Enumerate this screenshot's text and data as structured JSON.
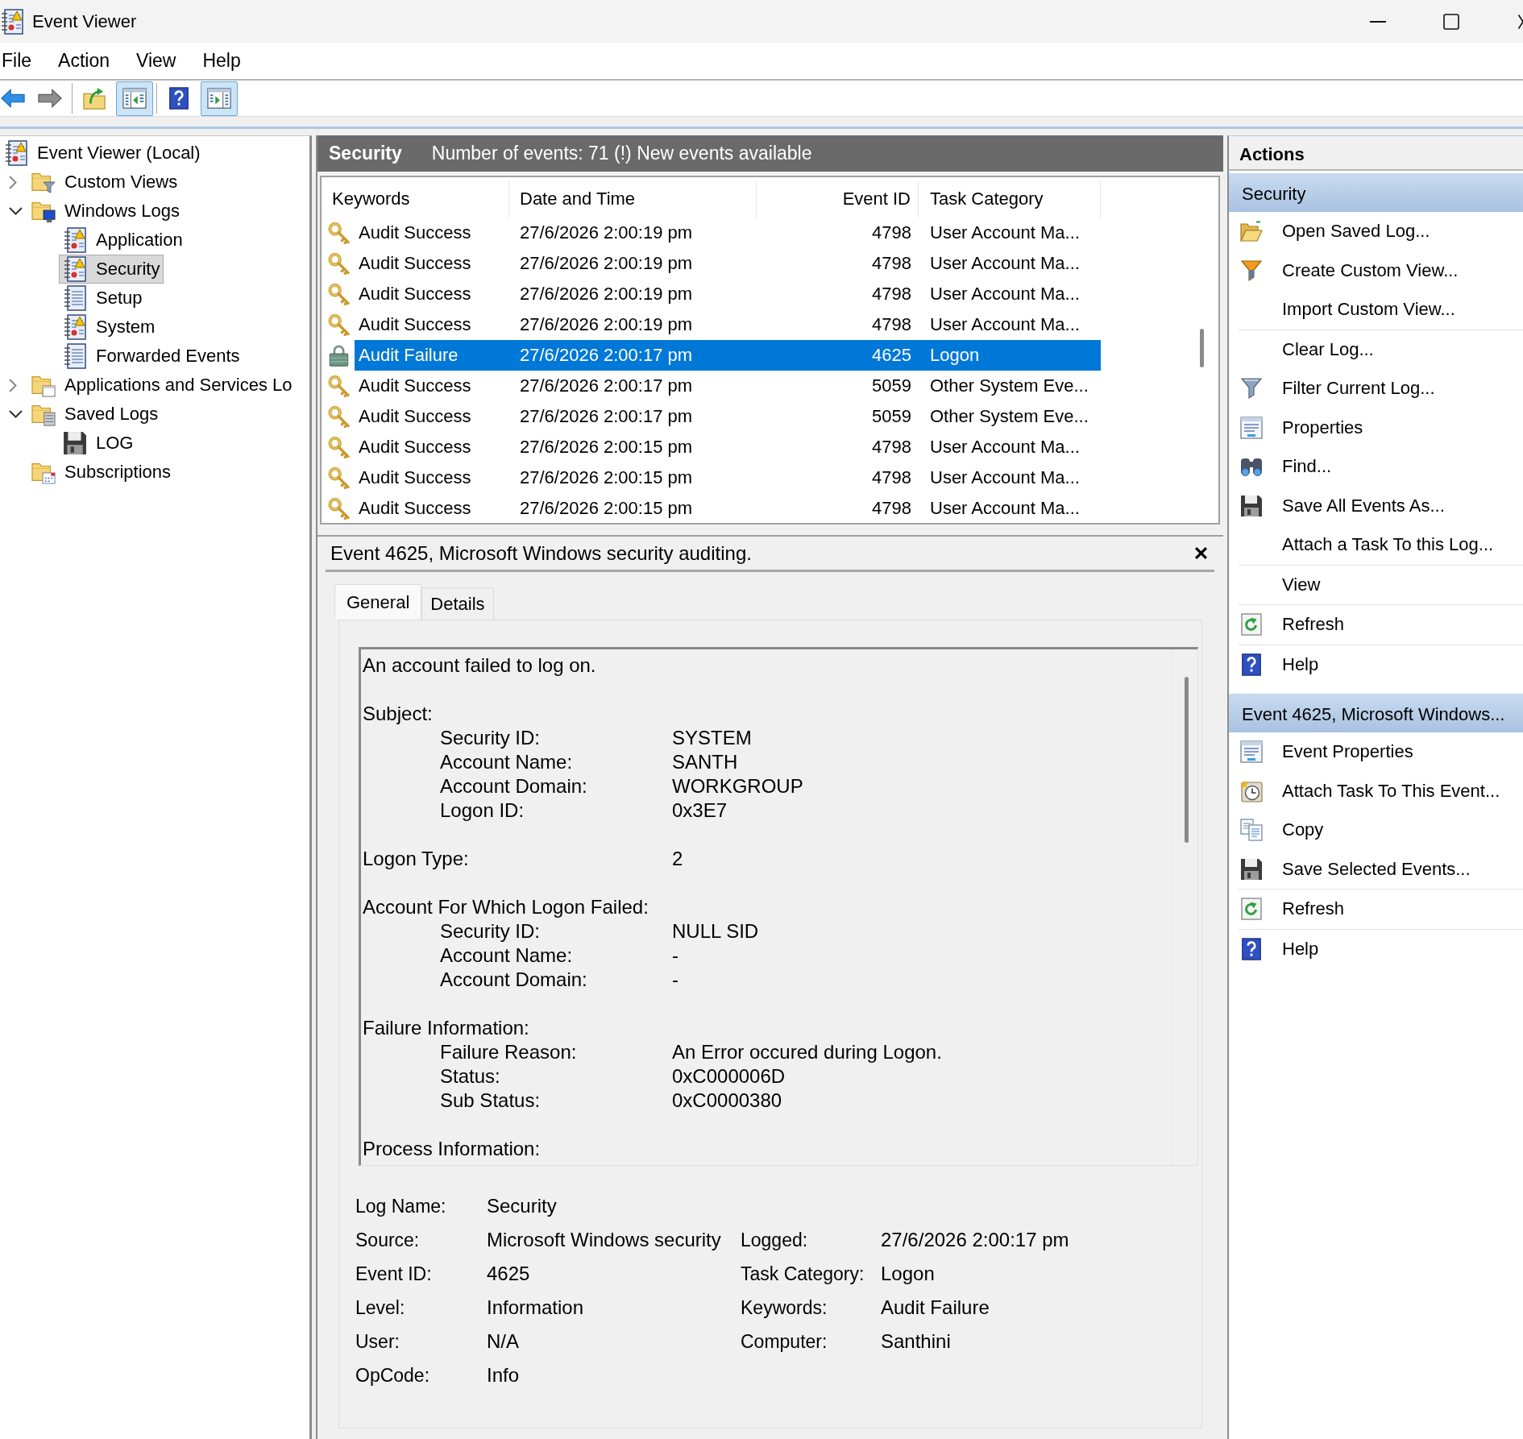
{
  "window": {
    "title": "Event Viewer"
  },
  "menu": [
    "File",
    "Action",
    "View",
    "Help"
  ],
  "toolbar": {
    "groups": [
      [
        {
          "kind": "back",
          "pressed": false
        },
        {
          "kind": "forward",
          "pressed": false
        }
      ],
      [
        {
          "kind": "open-folder",
          "pressed": false
        },
        {
          "kind": "console-tree",
          "pressed": true
        }
      ],
      [
        {
          "kind": "help",
          "pressed": false
        },
        {
          "kind": "action-pane",
          "pressed": true
        }
      ]
    ]
  },
  "tree": {
    "label": "Event Viewer (Local)",
    "kind": "root",
    "selected": false,
    "children": [
      {
        "label": "Custom Views",
        "kind": "filter-folder",
        "expanded": false,
        "selected": false
      },
      {
        "label": "Windows Logs",
        "kind": "system-folder",
        "expanded": true,
        "selected": false,
        "children": [
          {
            "label": "Application",
            "kind": "alert-log",
            "selected": false
          },
          {
            "label": "Security",
            "kind": "alert-log",
            "selected": true
          },
          {
            "label": "Setup",
            "kind": "plain-log",
            "selected": false
          },
          {
            "label": "System",
            "kind": "alert-log",
            "selected": false
          },
          {
            "label": "Forwarded Events",
            "kind": "plain-log",
            "selected": false
          }
        ]
      },
      {
        "label": "Applications and Services Lo",
        "kind": "window-folder",
        "expanded": false,
        "selected": false
      },
      {
        "label": "Saved Logs",
        "kind": "list-folder",
        "expanded": true,
        "selected": false,
        "children": [
          {
            "label": "LOG",
            "kind": "disk",
            "selected": false
          }
        ]
      },
      {
        "label": "Subscriptions",
        "kind": "calendar-folder",
        "selected": false
      }
    ]
  },
  "log_header": {
    "title": "Security",
    "summary": "Number of events: 71 (!) New events available"
  },
  "table": {
    "columns": [
      "Keywords",
      "Date and Time",
      "Event ID",
      "Task Category"
    ],
    "rows": [
      {
        "kind": "success",
        "keywords": "Audit Success",
        "date_time": "27/6/2026 2:00:19 pm",
        "event_id": "4798",
        "task_category": "User Account Ma...",
        "selected": false
      },
      {
        "kind": "success",
        "keywords": "Audit Success",
        "date_time": "27/6/2026 2:00:19 pm",
        "event_id": "4798",
        "task_category": "User Account Ma...",
        "selected": false
      },
      {
        "kind": "success",
        "keywords": "Audit Success",
        "date_time": "27/6/2026 2:00:19 pm",
        "event_id": "4798",
        "task_category": "User Account Ma...",
        "selected": false
      },
      {
        "kind": "success",
        "keywords": "Audit Success",
        "date_time": "27/6/2026 2:00:19 pm",
        "event_id": "4798",
        "task_category": "User Account Ma...",
        "selected": false
      },
      {
        "kind": "failure",
        "keywords": "Audit Failure",
        "date_time": "27/6/2026 2:00:17 pm",
        "event_id": "4625",
        "task_category": "Logon",
        "selected": true
      },
      {
        "kind": "success",
        "keywords": "Audit Success",
        "date_time": "27/6/2026 2:00:17 pm",
        "event_id": "5059",
        "task_category": "Other System Eve...",
        "selected": false
      },
      {
        "kind": "success",
        "keywords": "Audit Success",
        "date_time": "27/6/2026 2:00:17 pm",
        "event_id": "5059",
        "task_category": "Other System Eve...",
        "selected": false
      },
      {
        "kind": "success",
        "keywords": "Audit Success",
        "date_time": "27/6/2026 2:00:15 pm",
        "event_id": "4798",
        "task_category": "User Account Ma...",
        "selected": false
      },
      {
        "kind": "success",
        "keywords": "Audit Success",
        "date_time": "27/6/2026 2:00:15 pm",
        "event_id": "4798",
        "task_category": "User Account Ma...",
        "selected": false
      },
      {
        "kind": "success",
        "keywords": "Audit Success",
        "date_time": "27/6/2026 2:00:15 pm",
        "event_id": "4798",
        "task_category": "User Account Ma...",
        "selected": false
      }
    ]
  },
  "event_details": {
    "title": "Event 4625, Microsoft Windows security auditing.",
    "tabs": [
      {
        "label": "General",
        "selected": true
      },
      {
        "label": "Details",
        "selected": false
      }
    ],
    "description": "An account failed to log on.",
    "sections": [
      {
        "title": "Subject:",
        "fields": [
          {
            "label": "Security ID:",
            "value": "SYSTEM"
          },
          {
            "label": "Account Name:",
            "value": "SANTH"
          },
          {
            "label": "Account Domain:",
            "value": "WORKGROUP"
          },
          {
            "label": "Logon ID:",
            "value": "0x3E7"
          }
        ]
      },
      {
        "title": "Logon Type:",
        "value": "2"
      },
      {
        "title": "Account For Which Logon Failed:",
        "fields": [
          {
            "label": "Security ID:",
            "value": "NULL SID"
          },
          {
            "label": "Account Name:",
            "value": "-"
          },
          {
            "label": "Account Domain:",
            "value": "-"
          }
        ]
      },
      {
        "title": "Failure Information:",
        "fields": [
          {
            "label": "Failure Reason:",
            "value": "An Error occured during Logon."
          },
          {
            "label": "Status:",
            "value": "0xC000006D"
          },
          {
            "label": "Sub Status:",
            "value": "0xC0000380"
          }
        ]
      },
      {
        "title": "Process Information:"
      }
    ],
    "summary_rows": [
      [
        {
          "label": "Log Name:",
          "value": "Security"
        }
      ],
      [
        {
          "label": "Source:",
          "value": "Microsoft Windows security"
        },
        {
          "label": "Logged:",
          "value": "27/6/2026 2:00:17 pm"
        }
      ],
      [
        {
          "label": "Event ID:",
          "value": "4625"
        },
        {
          "label": "Task Category:",
          "value": "Logon"
        }
      ],
      [
        {
          "label": "Level:",
          "value": "Information"
        },
        {
          "label": "Keywords:",
          "value": "Audit Failure"
        }
      ],
      [
        {
          "label": "User:",
          "value": "N/A"
        },
        {
          "label": "Computer:",
          "value": "Santhini"
        }
      ],
      [
        {
          "label": "OpCode:",
          "value": "Info"
        }
      ]
    ]
  },
  "actions": {
    "title": "Actions",
    "sections": [
      {
        "title": "Security",
        "groups": [
          [
            {
              "kind": "open",
              "label": "Open Saved Log..."
            },
            {
              "kind": "create-filter",
              "label": "Create Custom View..."
            },
            {
              "kind": "plain",
              "label": "Import Custom View..."
            }
          ],
          [
            {
              "kind": "plain",
              "label": "Clear Log..."
            },
            {
              "kind": "filter",
              "label": "Filter Current Log..."
            },
            {
              "kind": "properties",
              "label": "Properties"
            },
            {
              "kind": "find",
              "label": "Find..."
            },
            {
              "kind": "save",
              "label": "Save All Events As..."
            },
            {
              "kind": "plain",
              "label": "Attach a Task To this Log..."
            }
          ],
          [
            {
              "kind": "plain",
              "label": "View"
            }
          ],
          [
            {
              "kind": "refresh",
              "label": "Refresh"
            }
          ],
          [
            {
              "kind": "help",
              "label": "Help"
            }
          ]
        ]
      },
      {
        "title": "Event 4625, Microsoft Windows...",
        "groups": [
          [
            {
              "kind": "properties",
              "label": "Event Properties"
            },
            {
              "kind": "task",
              "label": "Attach Task To This Event..."
            },
            {
              "kind": "copy",
              "label": "Copy"
            },
            {
              "kind": "save",
              "label": "Save Selected Events..."
            }
          ],
          [
            {
              "kind": "refresh",
              "label": "Refresh"
            }
          ],
          [
            {
              "kind": "help",
              "label": "Help"
            }
          ]
        ]
      }
    ]
  }
}
